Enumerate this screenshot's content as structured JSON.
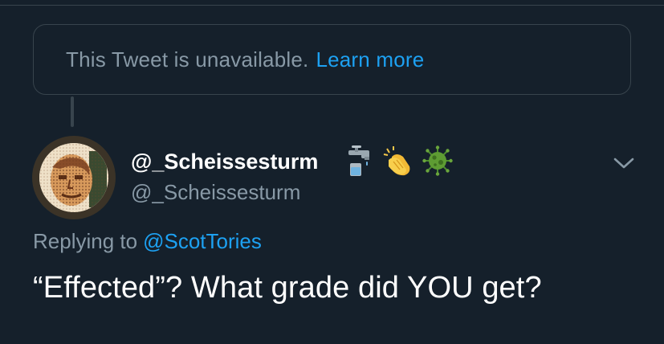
{
  "quoted_tweet": {
    "unavailable_text": "This Tweet is unavailable.",
    "learn_more_label": "Learn more"
  },
  "tweet": {
    "author": {
      "display_name": "@_Scheissesturm",
      "handle": "@_Scheissesturm",
      "name_emojis": [
        "potable-water-icon",
        "clapping-hands-icon",
        "virus-icon"
      ]
    },
    "replying_to": {
      "prefix": "Replying to",
      "mention": "@ScotTories"
    },
    "text": "“Effected”? What grade did YOU get?"
  },
  "colors": {
    "background": "#15202b",
    "border": "#38444d",
    "secondary_text": "#8899a6",
    "link": "#1da1f2",
    "primary_text": "#ffffff"
  }
}
